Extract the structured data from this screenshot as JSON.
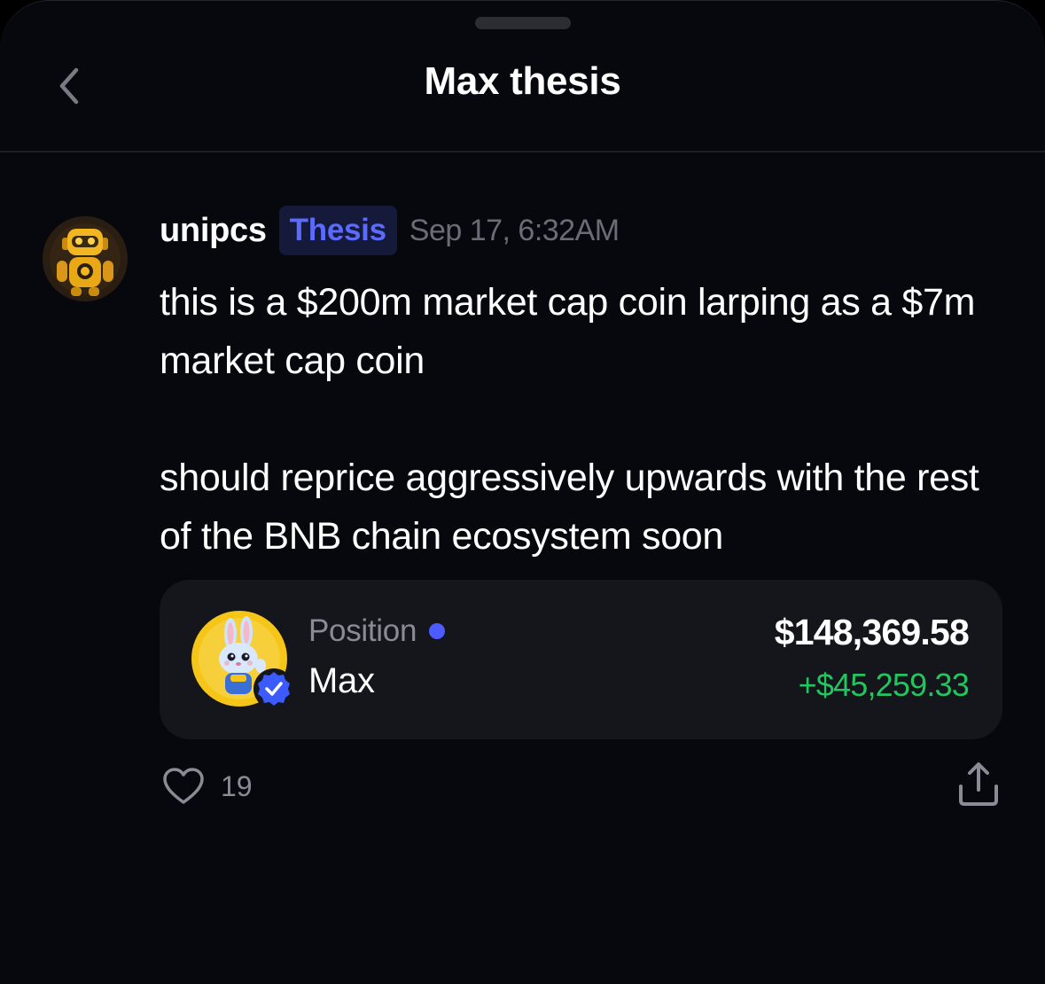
{
  "header": {
    "title": "Max thesis"
  },
  "post": {
    "author": "unipcs",
    "tag": "Thesis",
    "timestamp": "Sep 17, 6:32AM",
    "paragraphs": [
      "this is a $200m market cap coin larping as a $7m market cap coin",
      "should reprice aggressively upwards with the rest of the BNB chain ecosystem soon"
    ]
  },
  "position": {
    "label": "Position",
    "token": "Max",
    "value": "$148,369.58",
    "change": "+$45,259.33"
  },
  "actions": {
    "like_count": "19"
  },
  "colors": {
    "background": "#07070e",
    "card": "#15151c",
    "accent": "#5b6bff",
    "positive": "#22c55e",
    "muted": "#8b8b95"
  },
  "icons": {
    "back": "chevron-left-icon",
    "like": "heart-icon",
    "share": "share-icon",
    "verified": "verified-badge-icon"
  }
}
